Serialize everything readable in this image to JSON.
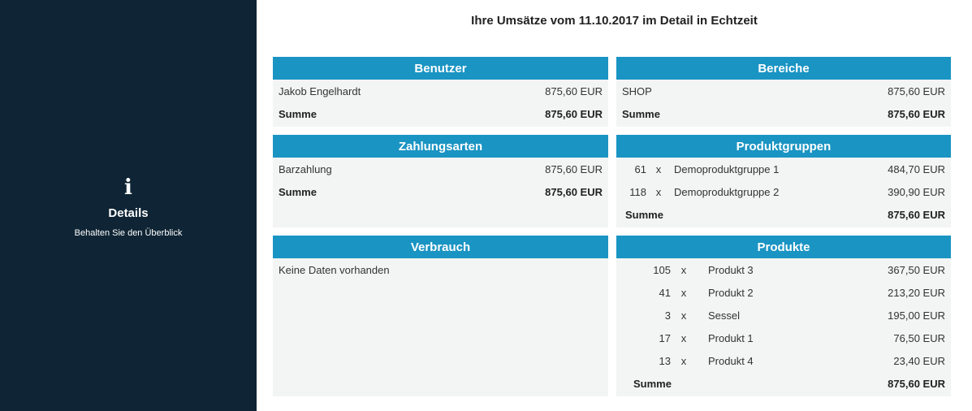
{
  "sidebar": {
    "title": "Details",
    "subtitle": "Behalten Sie den Überblick",
    "icon": "info-icon"
  },
  "page_title": "Ihre Umsätze vom 11.10.2017 im Detail in Echtzeit",
  "colors": {
    "sidebar_bg": "#0f2535",
    "header_bg": "#1a94c3",
    "panel_bg": "#f3f4f4"
  },
  "benutzer": {
    "title": "Benutzer",
    "rows": [
      {
        "label": "Jakob Engelhardt",
        "amount": "875,60 EUR"
      }
    ],
    "sum_label": "Summe",
    "sum_amount": "875,60 EUR"
  },
  "bereiche": {
    "title": "Bereiche",
    "rows": [
      {
        "label": "SHOP",
        "amount": "875,60 EUR"
      }
    ],
    "sum_label": "Summe",
    "sum_amount": "875,60 EUR"
  },
  "zahlungsarten": {
    "title": "Zahlungsarten",
    "rows": [
      {
        "label": "Barzahlung",
        "amount": "875,60 EUR"
      }
    ],
    "sum_label": "Summe",
    "sum_amount": "875,60 EUR"
  },
  "produktgruppen": {
    "title": "Produktgruppen",
    "rows": [
      {
        "qty": "61",
        "x": "x",
        "label": "Demoproduktgruppe 1",
        "amount": "484,70 EUR"
      },
      {
        "qty": "118",
        "x": "x",
        "label": "Demoproduktgruppe 2",
        "amount": "390,90 EUR"
      }
    ],
    "sum_label": "Summe",
    "sum_amount": "875,60 EUR"
  },
  "verbrauch": {
    "title": "Verbrauch",
    "empty_text": "Keine Daten vorhanden"
  },
  "produkte": {
    "title": "Produkte",
    "rows": [
      {
        "qty": "105",
        "x": "x",
        "label": "Produkt 3",
        "amount": "367,50 EUR"
      },
      {
        "qty": "41",
        "x": "x",
        "label": "Produkt 2",
        "amount": "213,20 EUR"
      },
      {
        "qty": "3",
        "x": "x",
        "label": "Sessel",
        "amount": "195,00 EUR"
      },
      {
        "qty": "17",
        "x": "x",
        "label": "Produkt 1",
        "amount": "76,50 EUR"
      },
      {
        "qty": "13",
        "x": "x",
        "label": "Produkt 4",
        "amount": "23,40 EUR"
      }
    ],
    "sum_label": "Summe",
    "sum_amount": "875,60 EUR"
  }
}
